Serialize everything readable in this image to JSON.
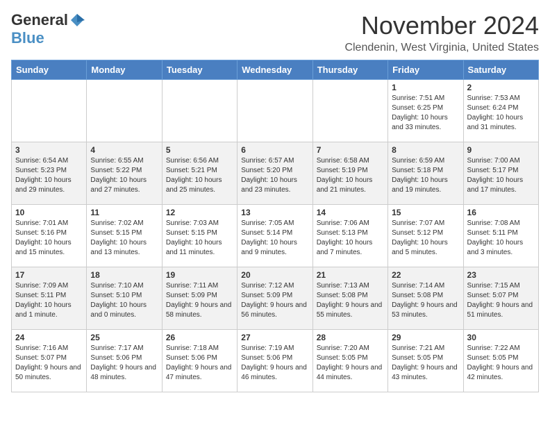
{
  "header": {
    "logo_general": "General",
    "logo_blue": "Blue",
    "month_title": "November 2024",
    "location": "Clendenin, West Virginia, United States"
  },
  "weekdays": [
    "Sunday",
    "Monday",
    "Tuesday",
    "Wednesday",
    "Thursday",
    "Friday",
    "Saturday"
  ],
  "weeks": [
    [
      {
        "day": "",
        "info": ""
      },
      {
        "day": "",
        "info": ""
      },
      {
        "day": "",
        "info": ""
      },
      {
        "day": "",
        "info": ""
      },
      {
        "day": "",
        "info": ""
      },
      {
        "day": "1",
        "info": "Sunrise: 7:51 AM\nSunset: 6:25 PM\nDaylight: 10 hours and 33 minutes."
      },
      {
        "day": "2",
        "info": "Sunrise: 7:53 AM\nSunset: 6:24 PM\nDaylight: 10 hours and 31 minutes."
      }
    ],
    [
      {
        "day": "3",
        "info": "Sunrise: 6:54 AM\nSunset: 5:23 PM\nDaylight: 10 hours and 29 minutes."
      },
      {
        "day": "4",
        "info": "Sunrise: 6:55 AM\nSunset: 5:22 PM\nDaylight: 10 hours and 27 minutes."
      },
      {
        "day": "5",
        "info": "Sunrise: 6:56 AM\nSunset: 5:21 PM\nDaylight: 10 hours and 25 minutes."
      },
      {
        "day": "6",
        "info": "Sunrise: 6:57 AM\nSunset: 5:20 PM\nDaylight: 10 hours and 23 minutes."
      },
      {
        "day": "7",
        "info": "Sunrise: 6:58 AM\nSunset: 5:19 PM\nDaylight: 10 hours and 21 minutes."
      },
      {
        "day": "8",
        "info": "Sunrise: 6:59 AM\nSunset: 5:18 PM\nDaylight: 10 hours and 19 minutes."
      },
      {
        "day": "9",
        "info": "Sunrise: 7:00 AM\nSunset: 5:17 PM\nDaylight: 10 hours and 17 minutes."
      }
    ],
    [
      {
        "day": "10",
        "info": "Sunrise: 7:01 AM\nSunset: 5:16 PM\nDaylight: 10 hours and 15 minutes."
      },
      {
        "day": "11",
        "info": "Sunrise: 7:02 AM\nSunset: 5:15 PM\nDaylight: 10 hours and 13 minutes."
      },
      {
        "day": "12",
        "info": "Sunrise: 7:03 AM\nSunset: 5:15 PM\nDaylight: 10 hours and 11 minutes."
      },
      {
        "day": "13",
        "info": "Sunrise: 7:05 AM\nSunset: 5:14 PM\nDaylight: 10 hours and 9 minutes."
      },
      {
        "day": "14",
        "info": "Sunrise: 7:06 AM\nSunset: 5:13 PM\nDaylight: 10 hours and 7 minutes."
      },
      {
        "day": "15",
        "info": "Sunrise: 7:07 AM\nSunset: 5:12 PM\nDaylight: 10 hours and 5 minutes."
      },
      {
        "day": "16",
        "info": "Sunrise: 7:08 AM\nSunset: 5:11 PM\nDaylight: 10 hours and 3 minutes."
      }
    ],
    [
      {
        "day": "17",
        "info": "Sunrise: 7:09 AM\nSunset: 5:11 PM\nDaylight: 10 hours and 1 minute."
      },
      {
        "day": "18",
        "info": "Sunrise: 7:10 AM\nSunset: 5:10 PM\nDaylight: 10 hours and 0 minutes."
      },
      {
        "day": "19",
        "info": "Sunrise: 7:11 AM\nSunset: 5:09 PM\nDaylight: 9 hours and 58 minutes."
      },
      {
        "day": "20",
        "info": "Sunrise: 7:12 AM\nSunset: 5:09 PM\nDaylight: 9 hours and 56 minutes."
      },
      {
        "day": "21",
        "info": "Sunrise: 7:13 AM\nSunset: 5:08 PM\nDaylight: 9 hours and 55 minutes."
      },
      {
        "day": "22",
        "info": "Sunrise: 7:14 AM\nSunset: 5:08 PM\nDaylight: 9 hours and 53 minutes."
      },
      {
        "day": "23",
        "info": "Sunrise: 7:15 AM\nSunset: 5:07 PM\nDaylight: 9 hours and 51 minutes."
      }
    ],
    [
      {
        "day": "24",
        "info": "Sunrise: 7:16 AM\nSunset: 5:07 PM\nDaylight: 9 hours and 50 minutes."
      },
      {
        "day": "25",
        "info": "Sunrise: 7:17 AM\nSunset: 5:06 PM\nDaylight: 9 hours and 48 minutes."
      },
      {
        "day": "26",
        "info": "Sunrise: 7:18 AM\nSunset: 5:06 PM\nDaylight: 9 hours and 47 minutes."
      },
      {
        "day": "27",
        "info": "Sunrise: 7:19 AM\nSunset: 5:06 PM\nDaylight: 9 hours and 46 minutes."
      },
      {
        "day": "28",
        "info": "Sunrise: 7:20 AM\nSunset: 5:05 PM\nDaylight: 9 hours and 44 minutes."
      },
      {
        "day": "29",
        "info": "Sunrise: 7:21 AM\nSunset: 5:05 PM\nDaylight: 9 hours and 43 minutes."
      },
      {
        "day": "30",
        "info": "Sunrise: 7:22 AM\nSunset: 5:05 PM\nDaylight: 9 hours and 42 minutes."
      }
    ]
  ]
}
